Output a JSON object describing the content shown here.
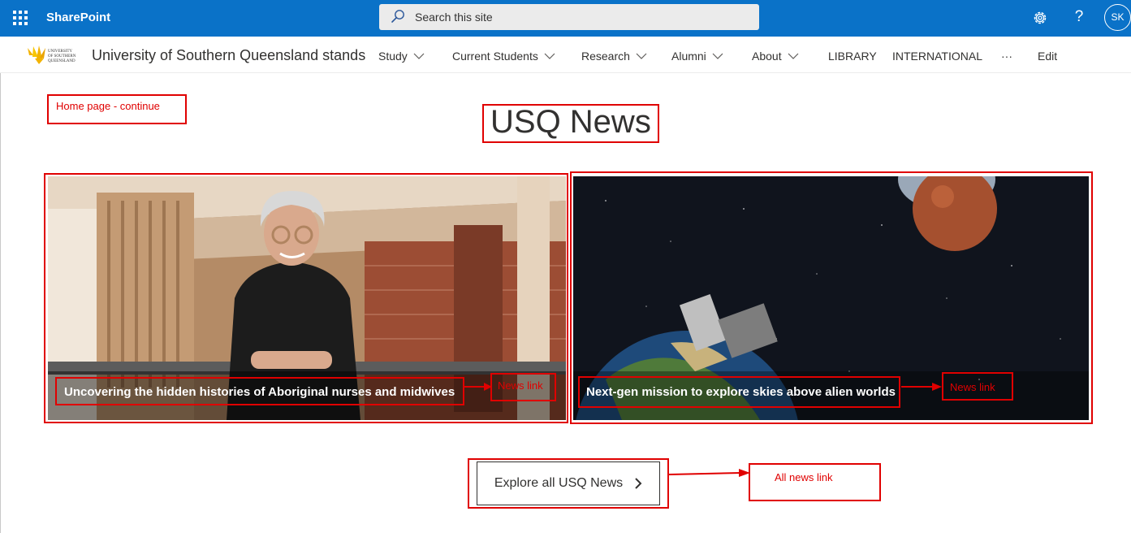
{
  "suitebar": {
    "app_name": "SharePoint",
    "search_placeholder": "Search this site",
    "avatar_initials": "SK",
    "help_glyph": "?"
  },
  "site": {
    "title": "University of Southern Queensland stands",
    "logo_text": "UNIVERSITY OF SOUTHERN QUEENSLAND",
    "nav": [
      {
        "label": "Study",
        "has_dropdown": true
      },
      {
        "label": "Current Students",
        "has_dropdown": true
      },
      {
        "label": "Research",
        "has_dropdown": true
      },
      {
        "label": "Alumni",
        "has_dropdown": true
      },
      {
        "label": "About",
        "has_dropdown": true
      },
      {
        "label": "LIBRARY",
        "has_dropdown": false
      },
      {
        "label": "INTERNATIONAL",
        "has_dropdown": false
      },
      {
        "label": "···",
        "has_dropdown": false
      },
      {
        "label": "Edit",
        "has_dropdown": false
      }
    ]
  },
  "main": {
    "heading": "USQ News",
    "news": [
      {
        "title": "Uncovering the hidden histories of Aboriginal nurses and midwives"
      },
      {
        "title": "Next-gen mission to explore skies above alien worlds"
      }
    ],
    "explore_label": "Explore all USQ News"
  },
  "annotations": {
    "home_continue": "Home page - continue",
    "news_link_1": "News link",
    "news_link_2": "News link",
    "all_news_link": "All news link"
  },
  "colors": {
    "suitebar": "#0a72c8",
    "annotation": "#e00000"
  }
}
